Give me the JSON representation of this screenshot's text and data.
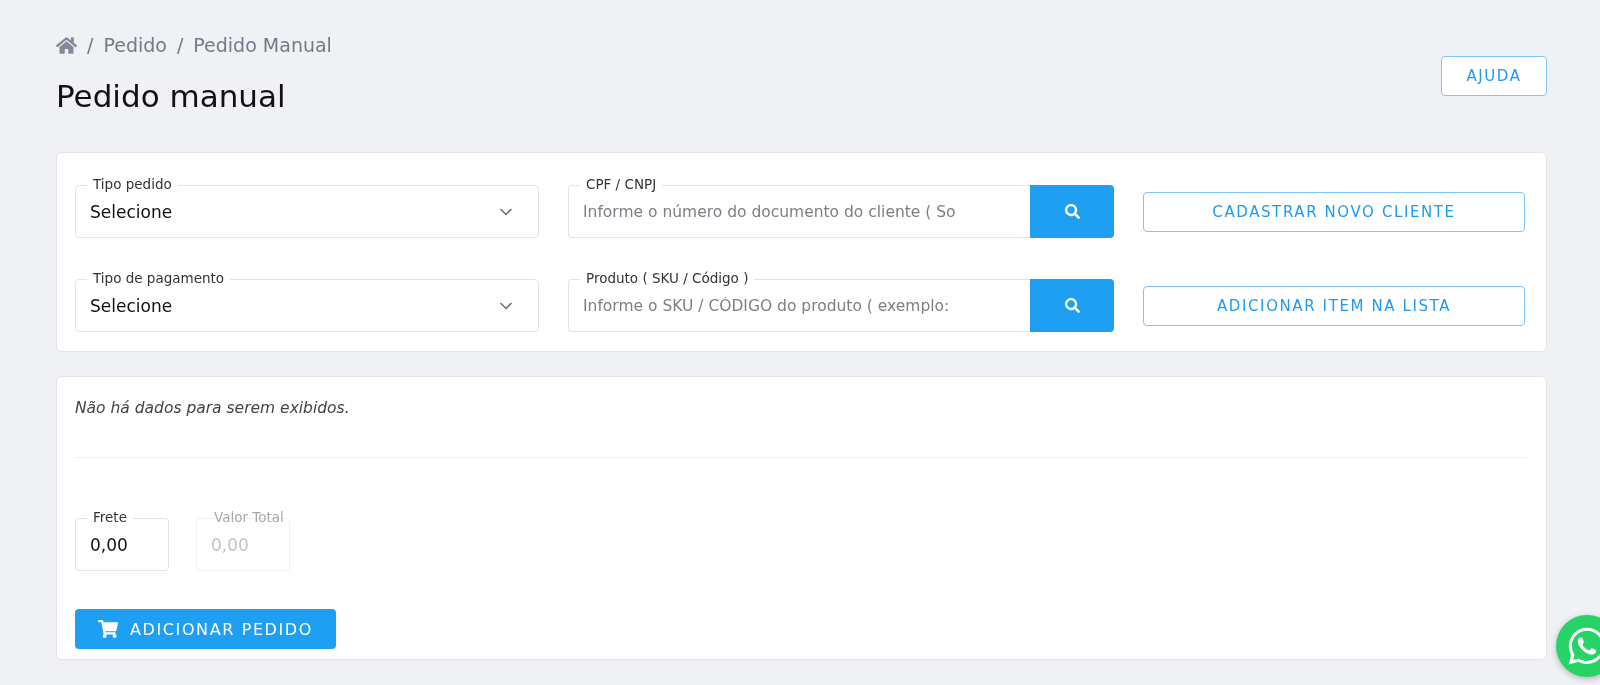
{
  "breadcrumb": [
    {
      "separator": "/",
      "label": "Pedido"
    },
    {
      "separator": "/",
      "label": "Pedido Manual"
    }
  ],
  "title": "Pedido manual",
  "help_button": "AJUDA",
  "form_rows": [
    {
      "select": {
        "label": "Tipo pedido",
        "value": "Selecione"
      },
      "search": {
        "label": "CPF / CNPJ",
        "placeholder": "Informe o número do documento do cliente ( So"
      },
      "button": "CADASTRAR NOVO CLIENTE"
    },
    {
      "select": {
        "label": "Tipo de pagamento",
        "value": "Selecione"
      },
      "search": {
        "label": "Produto ( SKU / Código )",
        "placeholder": "Informe o SKU / CÓDIGO do produto ( exemplo:"
      },
      "button": "ADICIONAR ITEM NA LISTA"
    }
  ],
  "empty_message": "Não há dados para serem exibidos.",
  "totals": [
    {
      "label": "Frete",
      "value": "0,00",
      "disabled": false
    },
    {
      "label": "Valor Total",
      "value": "0,00",
      "disabled": true
    }
  ],
  "submit_button": "ADICIONAR PEDIDO"
}
